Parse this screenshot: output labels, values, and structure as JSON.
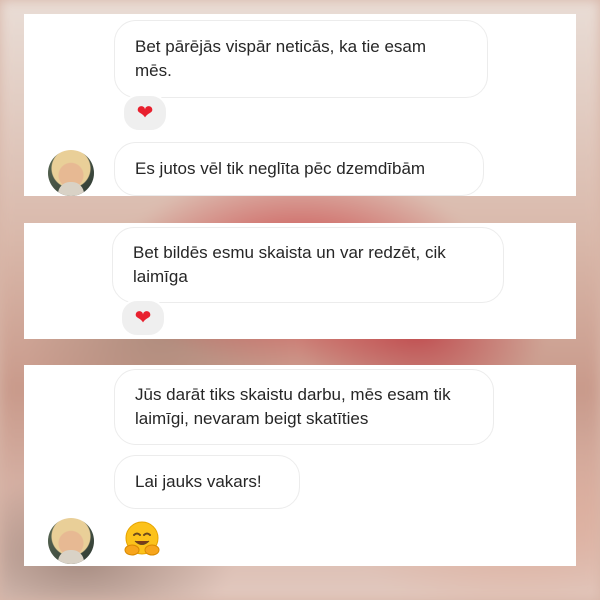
{
  "messages": [
    {
      "text": "Bet pārējās vispār neticās, ka tie esam mēs.",
      "reaction": "❤"
    },
    {
      "text": "Es jutos vēl tik neglīta pēc dzemdībām"
    },
    {
      "text": "Bet bildēs esmu skaista un var redzēt, cik laimīga",
      "reaction": "❤"
    },
    {
      "text": "Jūs darāt tiks skaistu darbu, mēs esam tik laimīgi, nevaram beigt skatīties"
    },
    {
      "text": "Lai jauks vakars!"
    },
    {
      "emoji": "hugging-face"
    }
  ],
  "colors": {
    "reaction": "#e8202e",
    "bubble_border": "#ececec",
    "text": "#262626"
  }
}
